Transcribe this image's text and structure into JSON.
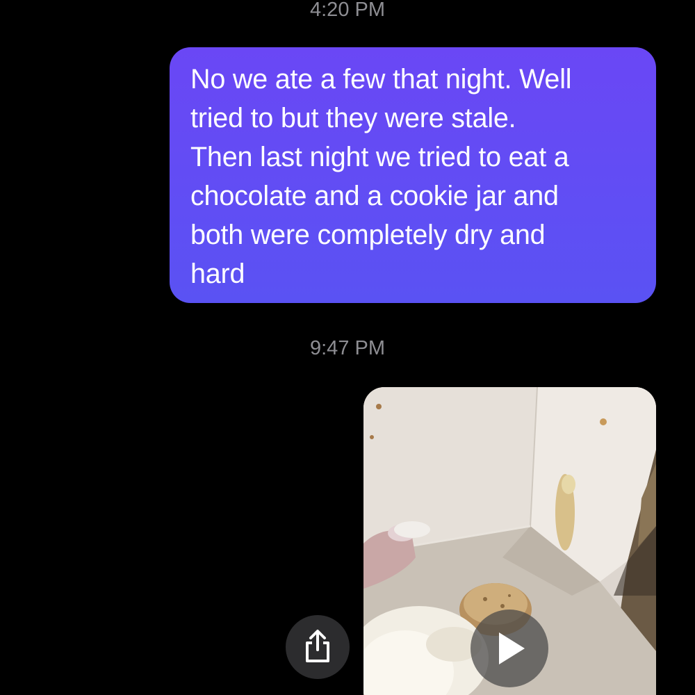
{
  "conversation": {
    "messages": [
      {
        "timestamp": "4:20 PM",
        "type": "text",
        "sender": "me",
        "lines": [
          "No we ate a few that night. Well",
          "tried to but they were stale.",
          "Then last night we tried to eat a",
          "chocolate and a cookie jar and",
          "both were completely dry and",
          "hard"
        ]
      },
      {
        "timestamp": "9:47 PM",
        "type": "video",
        "sender": "me",
        "thumbnail_icon": "video-thumbnail",
        "play_icon": "play-icon",
        "share_icon": "share-icon"
      }
    ]
  },
  "theme": {
    "background": "#000000",
    "outgoing_bubble": "#5e4ef4",
    "timestamp_color": "#8e8e93",
    "text_color": "#ffffff"
  }
}
